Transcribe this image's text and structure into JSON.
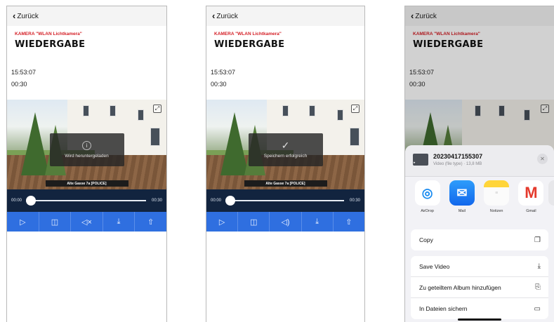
{
  "nav": {
    "back_label": "Zurück"
  },
  "header": {
    "camera_label": "KAMERA \"WLAN Lichtkamera\"",
    "title": "WIEDERGABE"
  },
  "recording": {
    "time": "15:53:07",
    "duration": "00:30"
  },
  "player": {
    "caption": "Alte Gasse 7a [POLICE]",
    "start_time": "00:00",
    "end_time": "00:30",
    "progress": 0.0,
    "controls": [
      "play",
      "snapshot",
      "mute",
      "download",
      "share"
    ]
  },
  "screens": [
    {
      "toast_text": "Wird heruntergeladen",
      "toast_icon": "info-icon"
    },
    {
      "toast_text": "Speichern erfolgreich",
      "toast_icon": "check-icon"
    }
  ],
  "share_sheet": {
    "file_name": "20230417155307",
    "file_meta": "Video (file type) · 13,8 MB",
    "apps": [
      {
        "label": "AirDrop",
        "icon": "airdrop-icon"
      },
      {
        "label": "Mail",
        "icon": "mail-icon"
      },
      {
        "label": "Notizen",
        "icon": "notes-icon"
      },
      {
        "label": "Gmail",
        "icon": "gmail-icon"
      }
    ],
    "actions": [
      {
        "label": "Copy",
        "icon": "copy-icon"
      },
      {
        "label": "Save Video",
        "icon": "save-icon"
      },
      {
        "label": "Zu geteiltem Album hinzufügen",
        "icon": "shared-album-icon"
      },
      {
        "label": "In Dateien sichern",
        "icon": "folder-icon"
      }
    ]
  },
  "colors": {
    "accent_red": "#d42027",
    "control_blue": "#2f6fe0",
    "scrubber_navy": "#12243f"
  }
}
